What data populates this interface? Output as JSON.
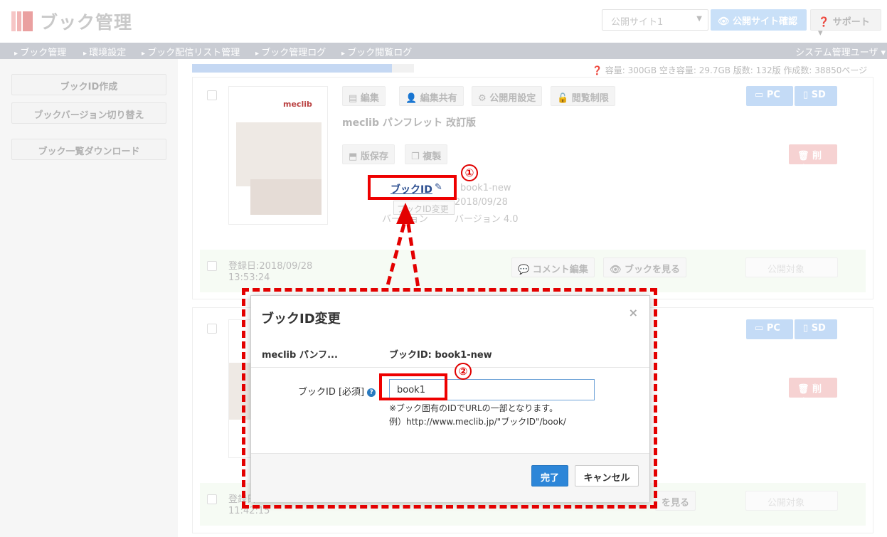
{
  "header": {
    "app_title": "ブック管理",
    "site_select": "公開サイト1",
    "confirm_button": "公開サイト確認",
    "support_button": "サポート"
  },
  "nav": {
    "items": [
      "ブック管理",
      "環境設定",
      "ブック配信リスト管理",
      "ブック管理ログ",
      "ブック閲覧ログ"
    ],
    "user_menu": "システム管理ユーザ"
  },
  "sidebar": {
    "create_id": "ブックID作成",
    "switch_version": "ブックバージョン切り替え",
    "download_list": "ブック一覧ダウンロード"
  },
  "capacity": {
    "progress_fraction": 0.9,
    "text": "容量: 300GB  空き容量: 29.7GB  版数: 132版  作成数: 38850ページ"
  },
  "card1": {
    "thumb_brand": "meclib",
    "edit": "編集",
    "share": "編集共有",
    "publish_settings": "公開用設定",
    "view_limit": "閲覧制限",
    "pc": "PC",
    "sd": "SD",
    "title": "meclib パンフレット 改訂版",
    "save_version": "版保存",
    "copy": "複製",
    "delete": "削除",
    "book_id_value": "book1-new",
    "date_value": "2018/09/28",
    "version_label": "バージョン",
    "version_value": "バージョン 4.0",
    "registered": "登録日:2018/09/28",
    "registered_time": "13:53:24",
    "comment_edit": "コメント編集",
    "view_book": "ブックを見る",
    "publish_target": "公開対象"
  },
  "card2": {
    "pc": "PC",
    "sd": "SD",
    "delete": "削除",
    "registered": "登録日",
    "registered_time": "11:42:15",
    "view_book": "を見る",
    "publish_target": "公開対象"
  },
  "annotation": {
    "book_id_link": "ブックID",
    "tooltip": "ブックID変更",
    "num1": "①",
    "num2": "②"
  },
  "modal": {
    "title": "ブックID変更",
    "book_name": "meclib パンフ...",
    "current_id": "ブックID: book1-new",
    "field_label": "ブックID [必須]",
    "input_value": "book1",
    "hint1": "※ブック固有のIDでURLの一部となります。",
    "hint2": "例）http://www.meclib.jp/\"ブックID\"/book/",
    "ok": "完了",
    "cancel": "キャンセル"
  }
}
